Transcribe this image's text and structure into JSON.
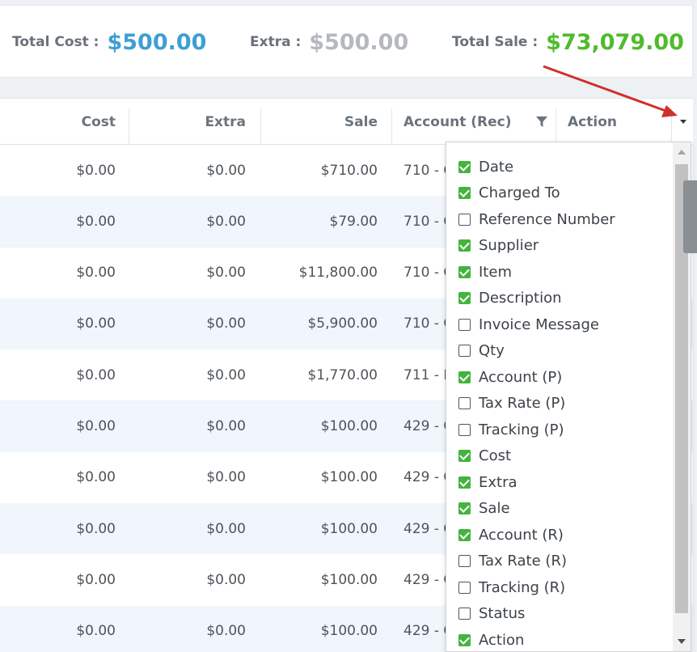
{
  "totals": {
    "cost_label": "Total Cost :",
    "cost_value": "$500.00",
    "extra_label": "Extra :",
    "extra_value": "$500.00",
    "sale_label": "Total Sale :",
    "sale_value": "$73,079.00"
  },
  "grid": {
    "headers": {
      "cost": "Cost",
      "extra": "Extra",
      "sale": "Sale",
      "account_rec": "Account (Rec)",
      "action": "Action"
    },
    "rows": [
      {
        "cost": "$0.00",
        "extra": "$0.00",
        "sale": "$710.00",
        "account": "710 - C"
      },
      {
        "cost": "$0.00",
        "extra": "$0.00",
        "sale": "$79.00",
        "account": "710 - C"
      },
      {
        "cost": "$0.00",
        "extra": "$0.00",
        "sale": "$11,800.00",
        "account": "710 - C"
      },
      {
        "cost": "$0.00",
        "extra": "$0.00",
        "sale": "$5,900.00",
        "account": "710 - C"
      },
      {
        "cost": "$0.00",
        "extra": "$0.00",
        "sale": "$1,770.00",
        "account": "711 - L"
      },
      {
        "cost": "$0.00",
        "extra": "$0.00",
        "sale": "$100.00",
        "account": "429 - C"
      },
      {
        "cost": "$0.00",
        "extra": "$0.00",
        "sale": "$100.00",
        "account": "429 - C"
      },
      {
        "cost": "$0.00",
        "extra": "$0.00",
        "sale": "$100.00",
        "account": "429 - C"
      },
      {
        "cost": "$0.00",
        "extra": "$0.00",
        "sale": "$100.00",
        "account": "429 - C"
      },
      {
        "cost": "$0.00",
        "extra": "$0.00",
        "sale": "$100.00",
        "account": "429 - C"
      }
    ]
  },
  "column_chooser": {
    "options": [
      {
        "label": "Date",
        "checked": true
      },
      {
        "label": "Charged To",
        "checked": true
      },
      {
        "label": "Reference Number",
        "checked": false
      },
      {
        "label": "Supplier",
        "checked": true
      },
      {
        "label": "Item",
        "checked": true
      },
      {
        "label": "Description",
        "checked": true
      },
      {
        "label": "Invoice Message",
        "checked": false
      },
      {
        "label": "Qty",
        "checked": false
      },
      {
        "label": "Account (P)",
        "checked": true
      },
      {
        "label": "Tax Rate (P)",
        "checked": false
      },
      {
        "label": "Tracking (P)",
        "checked": false
      },
      {
        "label": "Cost",
        "checked": true
      },
      {
        "label": "Extra",
        "checked": true
      },
      {
        "label": "Sale",
        "checked": true
      },
      {
        "label": "Account (R)",
        "checked": true
      },
      {
        "label": "Tax Rate (R)",
        "checked": false
      },
      {
        "label": "Tracking (R)",
        "checked": false
      },
      {
        "label": "Status",
        "checked": false
      },
      {
        "label": "Action",
        "checked": true
      }
    ]
  },
  "icons": {
    "filter": "filter-icon",
    "column_menu": "caret-down-icon",
    "checkbox_checked": "checkbox-checked-icon",
    "checkbox_unchecked": "checkbox-unchecked-icon"
  },
  "colors": {
    "cost_value": "#3d9fd3",
    "extra_value": "#b5b9be",
    "sale_value": "#4fbb2c",
    "checkbox_checked": "#45b33e",
    "annotation_arrow": "#d0302a",
    "row_alt": "#f0f6fb"
  }
}
